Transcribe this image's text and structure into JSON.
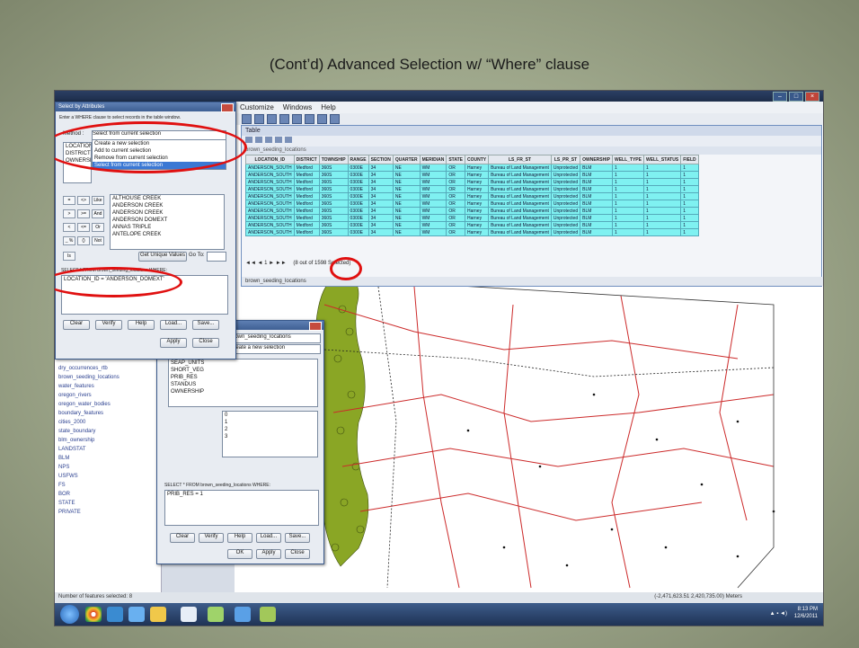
{
  "slide": {
    "title": "(Cont’d) Advanced Selection w/ “Where” clause"
  },
  "app": {
    "menu": [
      "Customize",
      "Windows",
      "Help"
    ]
  },
  "attribute_table": {
    "columns": [
      "LOCATION_ID",
      "DISTRICT",
      "TOWNSHIP",
      "RANGE",
      "SECTION",
      "QUARTER",
      "MERIDIAN",
      "STATE",
      "COUNTY",
      "LS_FR_ST",
      "LS_PR_ST",
      "OWNERSHIP",
      "WELL_TYPE",
      "WELL_STATUS",
      "FIELD"
    ],
    "rows": [
      [
        "ANDERSON_SOUTH",
        "Medford",
        "360S",
        "0300E",
        "34",
        "NE",
        "WM",
        "OR",
        "Harney",
        "Bureau of Land Management",
        "Unprotected",
        "BLM",
        "1",
        "1",
        "1"
      ],
      [
        "ANDERSON_SOUTH",
        "Medford",
        "360S",
        "0300E",
        "34",
        "NE",
        "WM",
        "OR",
        "Harney",
        "Bureau of Land Management",
        "Unprotected",
        "BLM",
        "1",
        "1",
        "1"
      ],
      [
        "ANDERSON_SOUTH",
        "Medford",
        "360S",
        "0300E",
        "34",
        "NE",
        "WM",
        "OR",
        "Harney",
        "Bureau of Land Management",
        "Unprotected",
        "BLM",
        "1",
        "1",
        "1"
      ],
      [
        "ANDERSON_SOUTH",
        "Medford",
        "360S",
        "0300E",
        "34",
        "NE",
        "WM",
        "OR",
        "Harney",
        "Bureau of Land Management",
        "Unprotected",
        "BLM",
        "1",
        "1",
        "1"
      ],
      [
        "ANDERSON_SOUTH",
        "Medford",
        "360S",
        "0300E",
        "34",
        "NE",
        "WM",
        "OR",
        "Harney",
        "Bureau of Land Management",
        "Unprotected",
        "BLM",
        "1",
        "1",
        "1"
      ],
      [
        "ANDERSON_SOUTH",
        "Medford",
        "360S",
        "0300E",
        "34",
        "NE",
        "WM",
        "OR",
        "Harney",
        "Bureau of Land Management",
        "Unprotected",
        "BLM",
        "1",
        "1",
        "1"
      ],
      [
        "ANDERSON_SOUTH",
        "Medford",
        "360S",
        "0300E",
        "34",
        "NE",
        "WM",
        "OR",
        "Harney",
        "Bureau of Land Management",
        "Unprotected",
        "BLM",
        "1",
        "1",
        "1"
      ],
      [
        "ANDERSON_SOUTH",
        "Medford",
        "360S",
        "0300E",
        "34",
        "NE",
        "WM",
        "OR",
        "Harney",
        "Bureau of Land Management",
        "Unprotected",
        "BLM",
        "1",
        "1",
        "1"
      ],
      [
        "ANDERSON_SOUTH",
        "Medford",
        "360S",
        "0300E",
        "34",
        "NE",
        "WM",
        "OR",
        "Harney",
        "Bureau of Land Management",
        "Unprotected",
        "BLM",
        "1",
        "1",
        "1"
      ],
      [
        "ANDERSON_SOUTH",
        "Medford",
        "360S",
        "0300E",
        "34",
        "NE",
        "WM",
        "OR",
        "Harney",
        "Bureau of Land Management",
        "Unprotected",
        "BLM",
        "1",
        "1",
        "1"
      ]
    ],
    "footer_nav": "1",
    "selected_count": "8 out of",
    "selected_suffix": "1598 Selected",
    "tab_name": "brown_seeding_locations"
  },
  "dialog_main": {
    "title": "Select by Attributes",
    "instruction": "Enter a WHERE clause to select records in the table window.",
    "method_label": "Method :",
    "method_value": "Select from current selection",
    "method_options": [
      "Create a new selection",
      "Add to current selection",
      "Remove from current selection",
      "Select from current selection"
    ],
    "fields": [
      "LOCATION_ID",
      "DISTRICT",
      "OWNERSHIP"
    ],
    "values": [
      "ALTHOUSE CREEK",
      "ANDERSON CREEK",
      "ANDERSON CREEK",
      "ANDERSON DOMEXT",
      "ANNAS TRIPLE",
      "ANTELOPE CREEK"
    ],
    "operators": [
      "=",
      "<>",
      "Like",
      ">",
      ">=",
      "And",
      "<",
      "<=",
      "Or",
      "_ %",
      "()",
      "Not",
      "Is"
    ],
    "get_unique": "Get Unique Values",
    "go_to": "Go To:",
    "query_prefix": "SELECT * FROM brown_seeding_locations WHERE:",
    "query": "LOCATION_ID = 'ANDERSON_DOMEXT'",
    "buttons": [
      "Clear",
      "Verify",
      "Help",
      "Load...",
      "Save..."
    ],
    "apply": "Apply",
    "close": "Close"
  },
  "dialog_second": {
    "layer_value": "brown_seeding_locations",
    "method_value": "Create a new selection",
    "fields": [
      "SEAP_UNITS",
      "SHORT_VEG",
      "PRIB_RES",
      "STANDUS",
      "OWNERSHIP"
    ],
    "values": [
      "0",
      "1",
      "2",
      "3"
    ],
    "query_prefix": "SELECT * FROM brown_seeding_locations WHERE:",
    "query": "PRIB_RES = 1",
    "buttons": [
      "Clear",
      "Verify",
      "Help",
      "Load...",
      "Save..."
    ],
    "ok": "OK",
    "apply": "Apply",
    "close": "Close"
  },
  "toc": {
    "items": [
      "dry_occurrences_rtb",
      "brown_seeding_locations",
      "water_features",
      "oregon_rivers",
      "oregon_water_bodies",
      "boundary_features",
      "cities_2000",
      "state_boundary",
      "blm_ownership",
      "LANDSTAT",
      "BLM",
      "NPS",
      "USFWS",
      "FS",
      "BOR",
      "STATE",
      "PRIVATE"
    ]
  },
  "status": {
    "left": "Number of features selected: 8",
    "right": "(-2,471,623.51  2,420,735.00) Meters"
  },
  "taskbar": {
    "clock_time": "8:13 PM",
    "clock_date": "12/6/2011"
  },
  "colors": {
    "highlight_row": "#7ff1f1",
    "annotation": "#e01010",
    "roads": "#cc2a2a",
    "vegetation": "#8aa625"
  }
}
